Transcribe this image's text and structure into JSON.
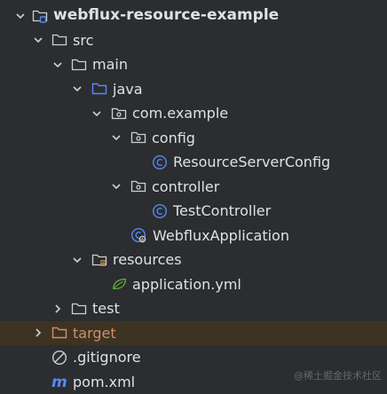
{
  "tree": {
    "root": {
      "label": "webflux-resource-example",
      "icon": "module-folder-icon"
    },
    "src": {
      "label": "src"
    },
    "main": {
      "label": "main"
    },
    "java": {
      "label": "java"
    },
    "package": {
      "label": "com.example"
    },
    "config": {
      "label": "config"
    },
    "resource_server_config": {
      "label": "ResourceServerConfig"
    },
    "controller": {
      "label": "controller"
    },
    "test_controller": {
      "label": "TestController"
    },
    "webflux_application": {
      "label": "WebfluxApplication"
    },
    "resources": {
      "label": "resources"
    },
    "application_yml": {
      "label": "application.yml"
    },
    "test": {
      "label": "test"
    },
    "target": {
      "label": "target"
    },
    "gitignore": {
      "label": ".gitignore"
    },
    "pom": {
      "label": "pom.xml"
    }
  },
  "watermark": "@稀土掘金技术社区",
  "colors": {
    "background": "#2b2d30",
    "text": "#dfe1e5",
    "excluded_folder": "#cf8e6d",
    "source_root": "#548af7",
    "class_icon": "#548af7",
    "spring_icon": "#5fb832",
    "selected_row": "#3d3322"
  }
}
